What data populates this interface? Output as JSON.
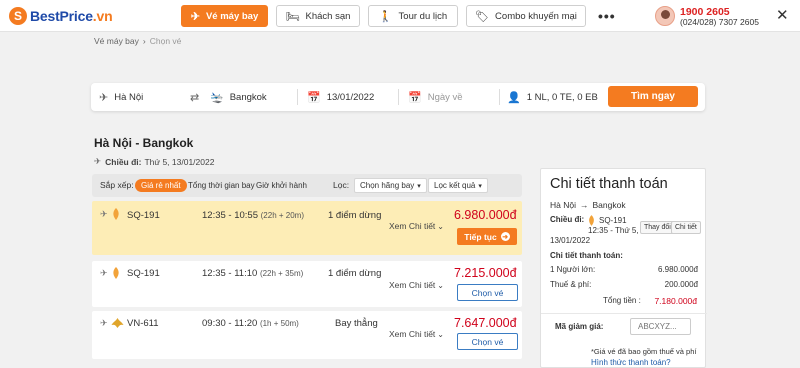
{
  "header": {
    "logo": "BestPrice.vn",
    "logo_prefix": "BestPrice",
    "logo_suffix": ".vn",
    "nav": [
      {
        "label": "Vé máy bay",
        "icon": "plane-icon",
        "active": true
      },
      {
        "label": "Khách sạn",
        "icon": "bed-icon",
        "active": false
      },
      {
        "label": "Tour du lịch",
        "icon": "traveler-icon",
        "active": false
      },
      {
        "label": "Combo khuyến mại",
        "icon": "tag-icon",
        "active": false
      }
    ],
    "hotline": "1900 2605",
    "phone": "(024/028) 7307 2605"
  },
  "breadcrumb": [
    "Vé máy bay",
    "Chọn vé"
  ],
  "search": {
    "from": "Hà Nội",
    "to": "Bangkok",
    "depart_date": "13/01/2022",
    "return_placeholder": "Ngày về",
    "passengers": "1 NL, 0 TE, 0 EB",
    "button": "Tìm ngay"
  },
  "route_title": "Hà Nội - Bangkok",
  "depart": {
    "label": "Chiều đi:",
    "value": "Thứ 5, 13/01/2022"
  },
  "sort": {
    "label": "Sắp xếp:",
    "options": [
      "Giá rẻ nhất",
      "Tổng thời gian bay",
      "Giờ khởi hành"
    ],
    "filter_label": "Lọc:",
    "filters": [
      "Chọn hãng bay",
      "Lọc kết quả"
    ]
  },
  "flights": [
    {
      "code": "SQ-191",
      "time": "12:35 - 10:55",
      "duration": "(22h + 20m)",
      "stops": "1 điểm dừng",
      "detail": "Xem Chi tiết",
      "price": "6.980.000đ",
      "action": "Tiếp tục",
      "highlight": true
    },
    {
      "code": "SQ-191",
      "time": "12:35 - 11:10",
      "duration": "(22h + 35m)",
      "stops": "1 điểm dừng",
      "detail": "Xem Chi tiết",
      "price": "7.215.000đ",
      "action": "Chọn vé",
      "highlight": false
    },
    {
      "code": "VN-611",
      "time": "09:30 - 11:20",
      "duration": "(1h + 50m)",
      "stops": "Bay thẳng",
      "detail": "Xem Chi tiết",
      "price": "7.647.000đ",
      "action": "Chọn vé",
      "highlight": false
    }
  ],
  "panel": {
    "title": "Chi tiết thanh toán",
    "from": "Hà Nội",
    "to": "Bangkok",
    "depart_label": "Chiều đi:",
    "flight_code": "SQ-191",
    "time": "12:35 - Thứ 5,",
    "date": "13/01/2022",
    "change_btn": "Thay đổi",
    "detail_btn": "Chi tiết",
    "section": "Chi tiết thanh toán:",
    "adult_label": "1 Người lớn:",
    "adult_value": "6.980.000đ",
    "tax_label": "Thuế & phí:",
    "tax_value": "200.000đ",
    "total_label": "Tổng tiền :",
    "total_value": "7.180.000đ",
    "coupon_label": "Mã giảm giá:",
    "coupon_placeholder": "ABCXYZ...",
    "note": "*Giá vé đã bao gồm thuế và phí",
    "payment_link": "Hình thức thanh toán?"
  },
  "colors": {
    "accent": "#f47b20",
    "price": "#d0021b",
    "highlight": "#fdedb6",
    "link": "#1f5ca8"
  }
}
